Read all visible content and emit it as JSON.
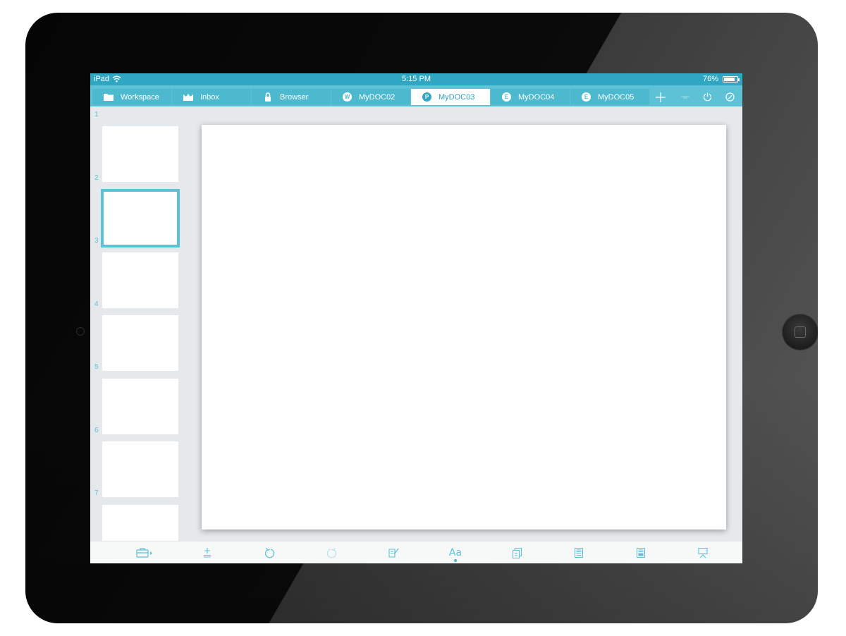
{
  "status_bar": {
    "device": "iPad",
    "time": "5:15 PM",
    "battery_percent": "76%",
    "battery_level": 0.76
  },
  "tabs": [
    {
      "label": "Workspace",
      "icon": "folder-icon",
      "active": false
    },
    {
      "label": "Inbox",
      "icon": "inbox-icon",
      "active": false
    },
    {
      "label": "Browser",
      "icon": "lock-icon",
      "active": false
    },
    {
      "label": "MyDOC02",
      "badge": "W",
      "active": false
    },
    {
      "label": "MyDOC03",
      "badge": "P",
      "active": true
    },
    {
      "label": "MyDOC04",
      "badge": "E",
      "active": false
    },
    {
      "label": "MyDOC05",
      "badge": "E",
      "active": false
    }
  ],
  "tab_bar_buttons": [
    "add-tab-icon",
    "minimize-icon",
    "power-icon",
    "compass-icon"
  ],
  "slides": [
    {
      "number": "1",
      "selected": false
    },
    {
      "number": "2",
      "selected": true
    },
    {
      "number": "3",
      "selected": false
    },
    {
      "number": "4",
      "selected": false
    },
    {
      "number": "5",
      "selected": false
    },
    {
      "number": "6",
      "selected": false
    },
    {
      "number": "7",
      "selected": false
    }
  ],
  "toolbar": {
    "items": [
      "toolbox-icon",
      "add-slide-icon",
      "undo-icon",
      "redo-icon",
      "edit-note-icon",
      "text-format-icon",
      "copy-slide-icon",
      "layout-icon",
      "notes-icon",
      "present-icon"
    ],
    "text_format_label": "Aa"
  },
  "colors": {
    "accent": "#2fa7c3",
    "tab_bar": "#5dc2d6",
    "selection": "#5cc3d6",
    "panel_bg": "#e6e9eb"
  }
}
